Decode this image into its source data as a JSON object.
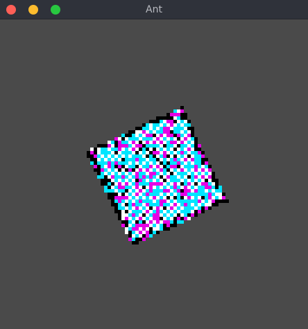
{
  "window": {
    "title": "Ant",
    "colors": {
      "titlebar": "#2f323a",
      "canvas_background": "#4a4a4a",
      "close": "#ff5f57",
      "minimize": "#febc2e",
      "maximize": "#28c840"
    }
  },
  "simulation": {
    "cell_palette": [
      "#000000",
      "#00e5ff",
      "#ffffff",
      "#e600e6"
    ]
  }
}
